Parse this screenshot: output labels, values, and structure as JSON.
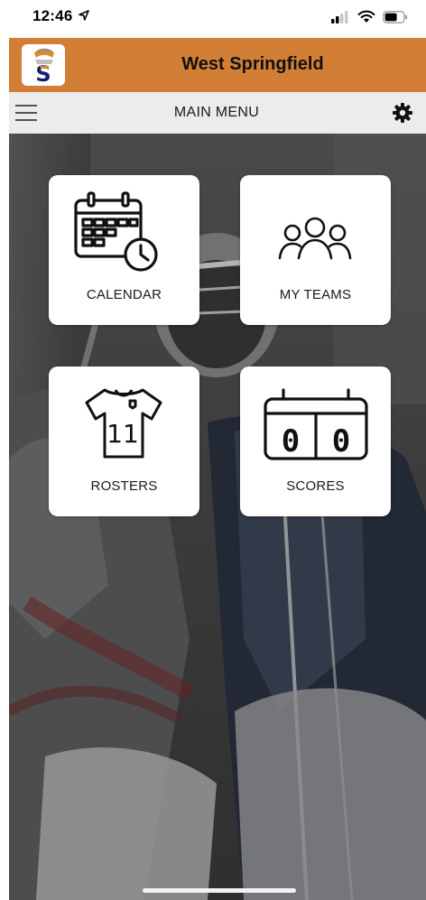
{
  "status_bar": {
    "time": "12:46"
  },
  "header": {
    "title": "West Springfield",
    "brand_color": "#d27f35"
  },
  "menu_bar": {
    "title": "MAIN MENU"
  },
  "tiles": [
    {
      "label": "CALENDAR",
      "icon": "calendar-icon"
    },
    {
      "label": "MY TEAMS",
      "icon": "team-icon"
    },
    {
      "label": "ROSTERS",
      "icon": "jersey-icon"
    },
    {
      "label": "SCORES",
      "icon": "scoreboard-icon"
    }
  ],
  "jersey_number": "11",
  "scoreboard_values": [
    "0",
    "0"
  ]
}
